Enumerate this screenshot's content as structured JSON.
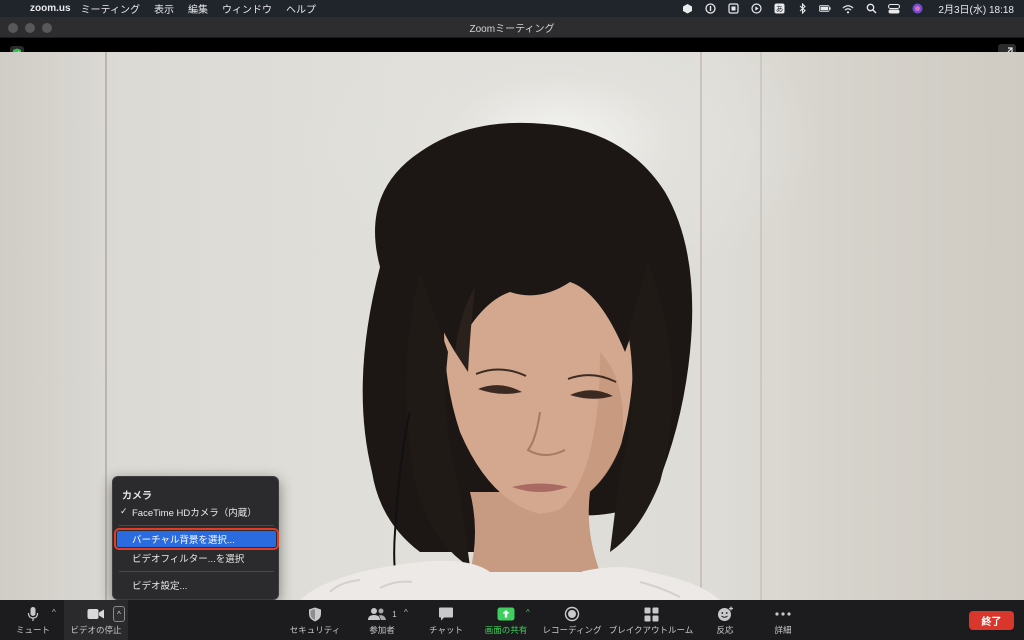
{
  "menubar": {
    "app_name": "zoom.us",
    "menus": [
      "ミーティング",
      "表示",
      "編集",
      "ウィンドウ",
      "ヘルプ"
    ],
    "clock": "2月3日(水)  18:18"
  },
  "window": {
    "title": "Zoomミーティング"
  },
  "camera_menu": {
    "header": "カメラ",
    "camera_item": "FaceTime HDカメラ（内蔵）",
    "check": "✓",
    "virtual_bg": "バーチャル背景を選択...",
    "video_filter": "ビデオフィルター...を選択",
    "video_settings": "ビデオ設定..."
  },
  "toolbar": {
    "mute": "ミュート",
    "stop_video": "ビデオの停止",
    "security": "セキュリティ",
    "participants": "参加者",
    "participants_count": "1",
    "chat": "チャット",
    "share": "画面の共有",
    "record": "レコーディング",
    "breakout": "ブレイクアウトルーム",
    "reactions": "反応",
    "more": "詳細",
    "end": "終了"
  },
  "colors": {
    "share_green": "#3fcf5f",
    "end_red": "#d9362c",
    "menu_selected": "#2a6ce0",
    "highlight_outline": "#e23c28"
  }
}
